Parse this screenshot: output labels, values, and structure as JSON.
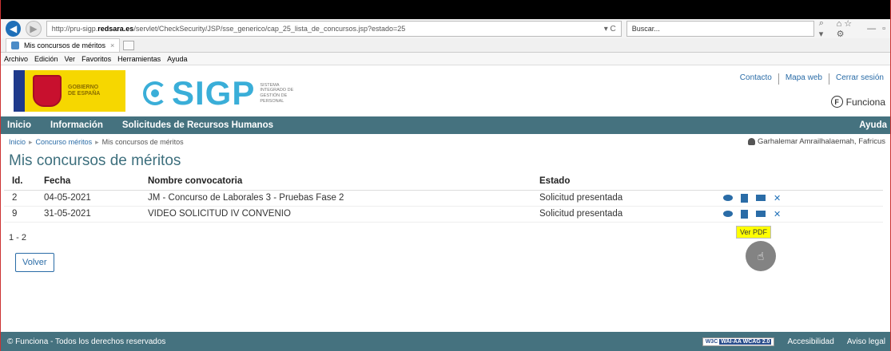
{
  "browser": {
    "url_prefix": "http://pru-sigp.",
    "url_domain": "redsara.es",
    "url_path": "/servlet/CheckSecurity/JSP/sse_generico/cap_25_lista_de_concursos.jsp?estado=25",
    "url_controls": "▾ C",
    "search_placeholder": "Buscar...",
    "search_icons": "⌕ ▾",
    "toolbar_icons": "⌂ ☆ ⚙",
    "tab_title": "Mis concursos de méritos",
    "tab_close": "×",
    "window_minimize": "—",
    "window_restore": "▫"
  },
  "menubar": [
    "Archivo",
    "Edición",
    "Ver",
    "Favoritos",
    "Herramientas",
    "Ayuda"
  ],
  "header": {
    "gobierno": "GOBIERNO\nDE ESPAÑA",
    "brand": "SIGP",
    "brand_sub": "SISTEMA\nINTEGRADO DE\nGESTIÓN DE\nPERSONAL",
    "links": [
      "Contacto",
      "Mapa web",
      "Cerrar sesión"
    ],
    "funciona": "Funciona",
    "funciona_mark": "F"
  },
  "nav": {
    "items": [
      "Inicio",
      "Información",
      "Solicitudes de Recursos Humanos"
    ],
    "help": "Ayuda"
  },
  "breadcrumb": {
    "items": [
      "Inicio",
      "Concurso méritos",
      "Mis concursos de méritos"
    ],
    "separator": "▸",
    "user": "Garhalemar Amrailhalaemah, Fafricus"
  },
  "page": {
    "title": "Mis concursos de méritos",
    "pager": "1 - 2",
    "back_button": "Volver",
    "tooltip": "Ver PDF",
    "delete_glyph": "✕",
    "cursor_glyph": "☝"
  },
  "table": {
    "headers": [
      "Id.",
      "Fecha",
      "Nombre convocatoria",
      "Estado"
    ],
    "rows": [
      [
        "2",
        "04-05-2021",
        "JM - Concurso de Laborales 3 - Pruebas Fase 2",
        "Solicitud presentada"
      ],
      [
        "9",
        "31-05-2021",
        "VIDEO SOLICITUD IV CONVENIO",
        "Solicitud presentada"
      ]
    ]
  },
  "footer": {
    "copyright": "© Funciona - Todos los derechos reservados",
    "w3c": "W3C",
    "wai": "WAI-AA WCAG 2.0",
    "links": [
      "Accesibilidad",
      "Aviso legal"
    ]
  }
}
